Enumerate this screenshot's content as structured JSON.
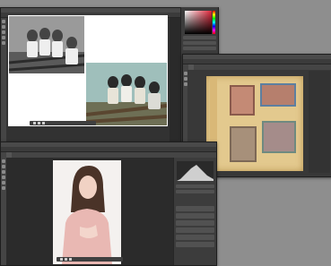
{
  "windows": {
    "top_left": {
      "tab_title": "",
      "bottom_bar": [
        "",
        "",
        ""
      ]
    },
    "right": {
      "tab_title": ""
    },
    "bottom": {
      "tab_title": "",
      "canvas_toolbar": [
        "",
        ""
      ]
    }
  },
  "panels": {
    "color_picker": {
      "hue_color": "#e0263a"
    }
  },
  "colors": {
    "desktop": "#8e8e8e",
    "app_bg": "#323232",
    "panel_bg": "#3c3c3c",
    "sepia_page": "#e3c98e"
  }
}
